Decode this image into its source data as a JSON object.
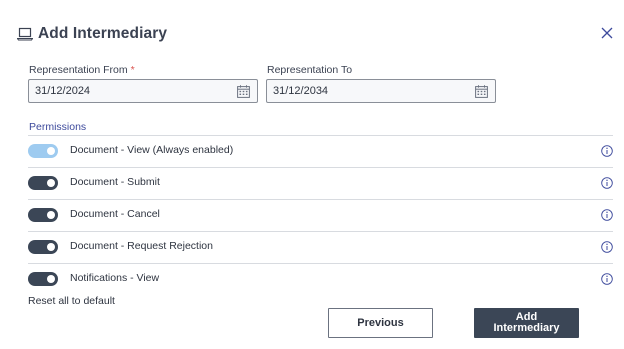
{
  "dialog": {
    "title": "Add Intermediary",
    "title_icon": "laptop-icon",
    "close_icon": "close-icon"
  },
  "form": {
    "from": {
      "label": "Representation From",
      "required_mark": "*",
      "value": "31/12/2024",
      "icon": "calendar-icon"
    },
    "to": {
      "label": "Representation To",
      "value": "31/12/2034",
      "icon": "calendar-icon"
    }
  },
  "permissions": {
    "heading": "Permissions",
    "items": [
      {
        "label": "Document - View (Always enabled)",
        "state": "on-disabled"
      },
      {
        "label": "Document - Submit",
        "state": "on"
      },
      {
        "label": "Document - Cancel",
        "state": "on"
      },
      {
        "label": "Document - Request Rejection",
        "state": "on"
      },
      {
        "label": "Notifications - View",
        "state": "on"
      }
    ],
    "info_icon": "info-icon"
  },
  "footer": {
    "reset_label": "Reset all to default",
    "previous_label": "Previous",
    "add_label": "Add\nIntermediary"
  },
  "colors": {
    "accent": "#3b4656",
    "heading": "#3d4a9c",
    "toggle_disabled": "#9ecbf0",
    "required": "#d9534f"
  }
}
